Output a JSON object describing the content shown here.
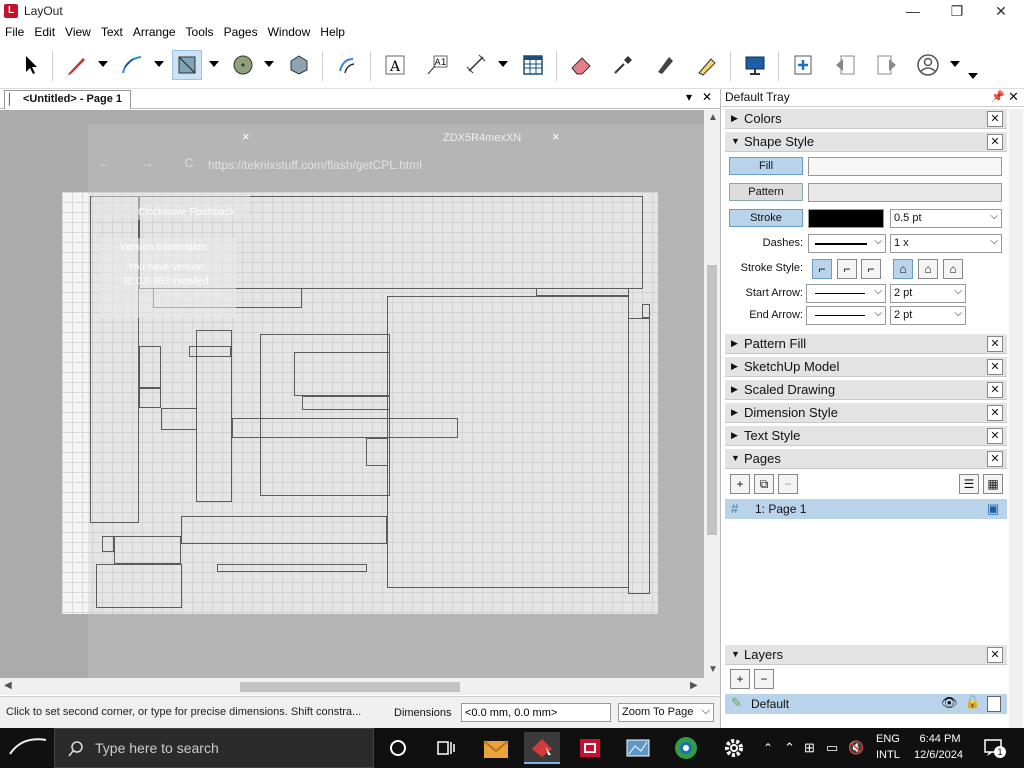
{
  "window": {
    "title": "LayOut",
    "minimize": "—",
    "maximize": "❐",
    "close": "✕"
  },
  "menu": [
    "File",
    "Edit",
    "View",
    "Text",
    "Arrange",
    "Tools",
    "Pages",
    "Window",
    "Help"
  ],
  "document": {
    "tab_label": "<Untitled> - Page 1",
    "tab_marker": "▏"
  },
  "canvas_overlay": {
    "browser_tab": "ZDX5R4mexXN",
    "url": "https://teknixstuff.com/flash/getCPL.html",
    "nav": "← → C",
    "flash_title": "Clockwave Flashback",
    "version_title": "Version Information",
    "version_line1": "You have version",
    "version_line2": "32.0.0.363 installed",
    "close_glyph": "×"
  },
  "statusbar": {
    "hint": "Click to set second corner, or type for precise dimensions. Shift constra...",
    "dimensions_label": "Dimensions",
    "dimensions_value": "<0.0 mm, 0.0 mm>",
    "zoom": "Zoom To Page"
  },
  "tray": {
    "title": "Default Tray",
    "colors": "Colors",
    "shape_style": "Shape Style",
    "fill": "Fill",
    "pattern": "Pattern",
    "stroke": "Stroke",
    "stroke_weight": "0.5 pt",
    "dashes_label": "Dashes:",
    "dash_scale": "1 x",
    "stroke_style_label": "Stroke Style:",
    "start_arrow_label": "Start Arrow:",
    "start_arrow_size": "2 pt",
    "end_arrow_label": "End Arrow:",
    "end_arrow_size": "2 pt",
    "pattern_fill": "Pattern Fill",
    "sketchup_model": "SketchUp Model",
    "scaled_drawing": "Scaled Drawing",
    "dimension_style": "Dimension Style",
    "text_style": "Text Style",
    "pages": "Pages",
    "page_item": "1:  Page 1",
    "layers": "Layers",
    "layer_item": "Default"
  },
  "taskbar": {
    "search_placeholder": "Type here to search",
    "lang1": "ENG",
    "lang2": "INTL",
    "time": "6:44 PM",
    "date": "12/6/2024",
    "notifications": "1"
  },
  "colors": {
    "accent": "#b9d3eb",
    "canvas": "#ababab",
    "taskbar": "#101010"
  }
}
